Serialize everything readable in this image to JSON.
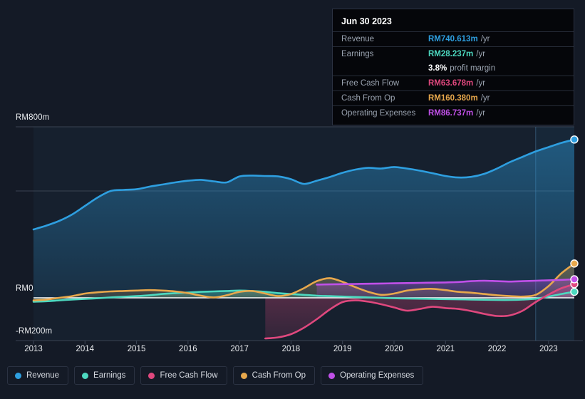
{
  "tooltip": {
    "date": "Jun 30 2023",
    "rows": [
      {
        "key": "Revenue",
        "value": "RM740.613m",
        "unit": "/yr",
        "color": "#2e9fe0"
      },
      {
        "key": "Earnings",
        "value": "RM28.237m",
        "unit": "/yr",
        "color": "#4dd9c0"
      },
      {
        "key": "",
        "value": "3.8%",
        "unit": "profit margin",
        "color": "#ffffff"
      },
      {
        "key": "Free Cash Flow",
        "value": "RM63.678m",
        "unit": "/yr",
        "color": "#e0487e"
      },
      {
        "key": "Cash From Op",
        "value": "RM160.380m",
        "unit": "/yr",
        "color": "#e8a84c"
      },
      {
        "key": "Operating Expenses",
        "value": "RM86.737m",
        "unit": "/yr",
        "color": "#c050e8"
      }
    ]
  },
  "legend": [
    {
      "label": "Revenue",
      "color": "#2e9fe0",
      "icon": "series-dot-icon"
    },
    {
      "label": "Earnings",
      "color": "#4dd9c0",
      "icon": "series-dot-icon"
    },
    {
      "label": "Free Cash Flow",
      "color": "#e0487e",
      "icon": "series-dot-icon"
    },
    {
      "label": "Cash From Op",
      "color": "#e8a84c",
      "icon": "series-dot-icon"
    },
    {
      "label": "Operating Expenses",
      "color": "#c050e8",
      "icon": "series-dot-icon"
    }
  ],
  "axis": {
    "y_labels": [
      "RM800m",
      "RM0",
      "-RM200m"
    ],
    "y_top": "RM800m",
    "y_zero": "RM0",
    "y_bottom": "-RM200m"
  },
  "chart_data": {
    "type": "area",
    "title": "",
    "xlabel": "",
    "ylabel": "",
    "currency": "RM",
    "unit": "m",
    "ylim": [
      -200,
      800
    ],
    "grid": true,
    "legend_position": "bottom",
    "x": [
      2013.0,
      2013.25,
      2013.5,
      2013.75,
      2014.0,
      2014.25,
      2014.5,
      2014.75,
      2015.0,
      2015.25,
      2015.5,
      2015.75,
      2016.0,
      2016.25,
      2016.5,
      2016.75,
      2017.0,
      2017.25,
      2017.5,
      2017.75,
      2018.0,
      2018.25,
      2018.5,
      2018.75,
      2019.0,
      2019.25,
      2019.5,
      2019.75,
      2020.0,
      2020.25,
      2020.5,
      2020.75,
      2021.0,
      2021.25,
      2021.5,
      2021.75,
      2022.0,
      2022.25,
      2022.5,
      2022.75,
      2023.0,
      2023.25,
      2023.5
    ],
    "xticks": [
      2013,
      2014,
      2015,
      2016,
      2017,
      2018,
      2019,
      2020,
      2021,
      2022,
      2023
    ],
    "yticks": [
      800,
      0,
      -200
    ],
    "highlight_x": 2023.5,
    "series": [
      {
        "name": "Revenue",
        "color": "#2e9fe0",
        "values": [
          320,
          338,
          360,
          390,
          430,
          470,
          500,
          505,
          508,
          520,
          530,
          540,
          548,
          552,
          545,
          540,
          568,
          572,
          570,
          568,
          555,
          533,
          548,
          565,
          585,
          600,
          608,
          605,
          612,
          605,
          595,
          583,
          570,
          563,
          566,
          580,
          605,
          635,
          660,
          685,
          705,
          725,
          740.613
        ]
      },
      {
        "name": "Earnings",
        "color": "#4dd9c0",
        "values": [
          -18,
          -16,
          -12,
          -8,
          -5,
          -2,
          2,
          5,
          8,
          12,
          18,
          22,
          25,
          28,
          30,
          32,
          34,
          32,
          28,
          22,
          18,
          14,
          10,
          8,
          6,
          4,
          2,
          0,
          -2,
          -3,
          -4,
          -5,
          -6,
          -7,
          -8,
          -9,
          -10,
          -10,
          -8,
          -4,
          6,
          18,
          28.237
        ]
      },
      {
        "name": "Free Cash Flow",
        "color": "#e0487e",
        "values": [
          null,
          null,
          null,
          null,
          null,
          null,
          null,
          null,
          null,
          null,
          null,
          null,
          null,
          null,
          null,
          null,
          null,
          null,
          -190,
          -185,
          -170,
          -140,
          -100,
          -55,
          -20,
          -12,
          -18,
          -30,
          -45,
          -60,
          -52,
          -42,
          -48,
          -52,
          -62,
          -75,
          -85,
          -82,
          -60,
          -20,
          15,
          45,
          63.678
        ]
      },
      {
        "name": "Cash From Op",
        "color": "#e8a84c",
        "values": [
          -12,
          -8,
          0,
          8,
          20,
          26,
          30,
          32,
          34,
          36,
          34,
          30,
          22,
          10,
          2,
          12,
          28,
          32,
          20,
          8,
          18,
          45,
          78,
          92,
          75,
          50,
          28,
          14,
          20,
          34,
          40,
          42,
          36,
          28,
          24,
          18,
          12,
          8,
          6,
          14,
          55,
          115,
          160.38
        ]
      },
      {
        "name": "Operating Expenses",
        "color": "#c050e8",
        "values": [
          null,
          null,
          null,
          null,
          null,
          null,
          null,
          null,
          null,
          null,
          null,
          null,
          null,
          null,
          null,
          null,
          null,
          null,
          null,
          null,
          null,
          null,
          62,
          63,
          64,
          65,
          66,
          67,
          68,
          69,
          70,
          71,
          72,
          74,
          78,
          80,
          78,
          76,
          78,
          80,
          82,
          84,
          86.737
        ]
      }
    ]
  }
}
